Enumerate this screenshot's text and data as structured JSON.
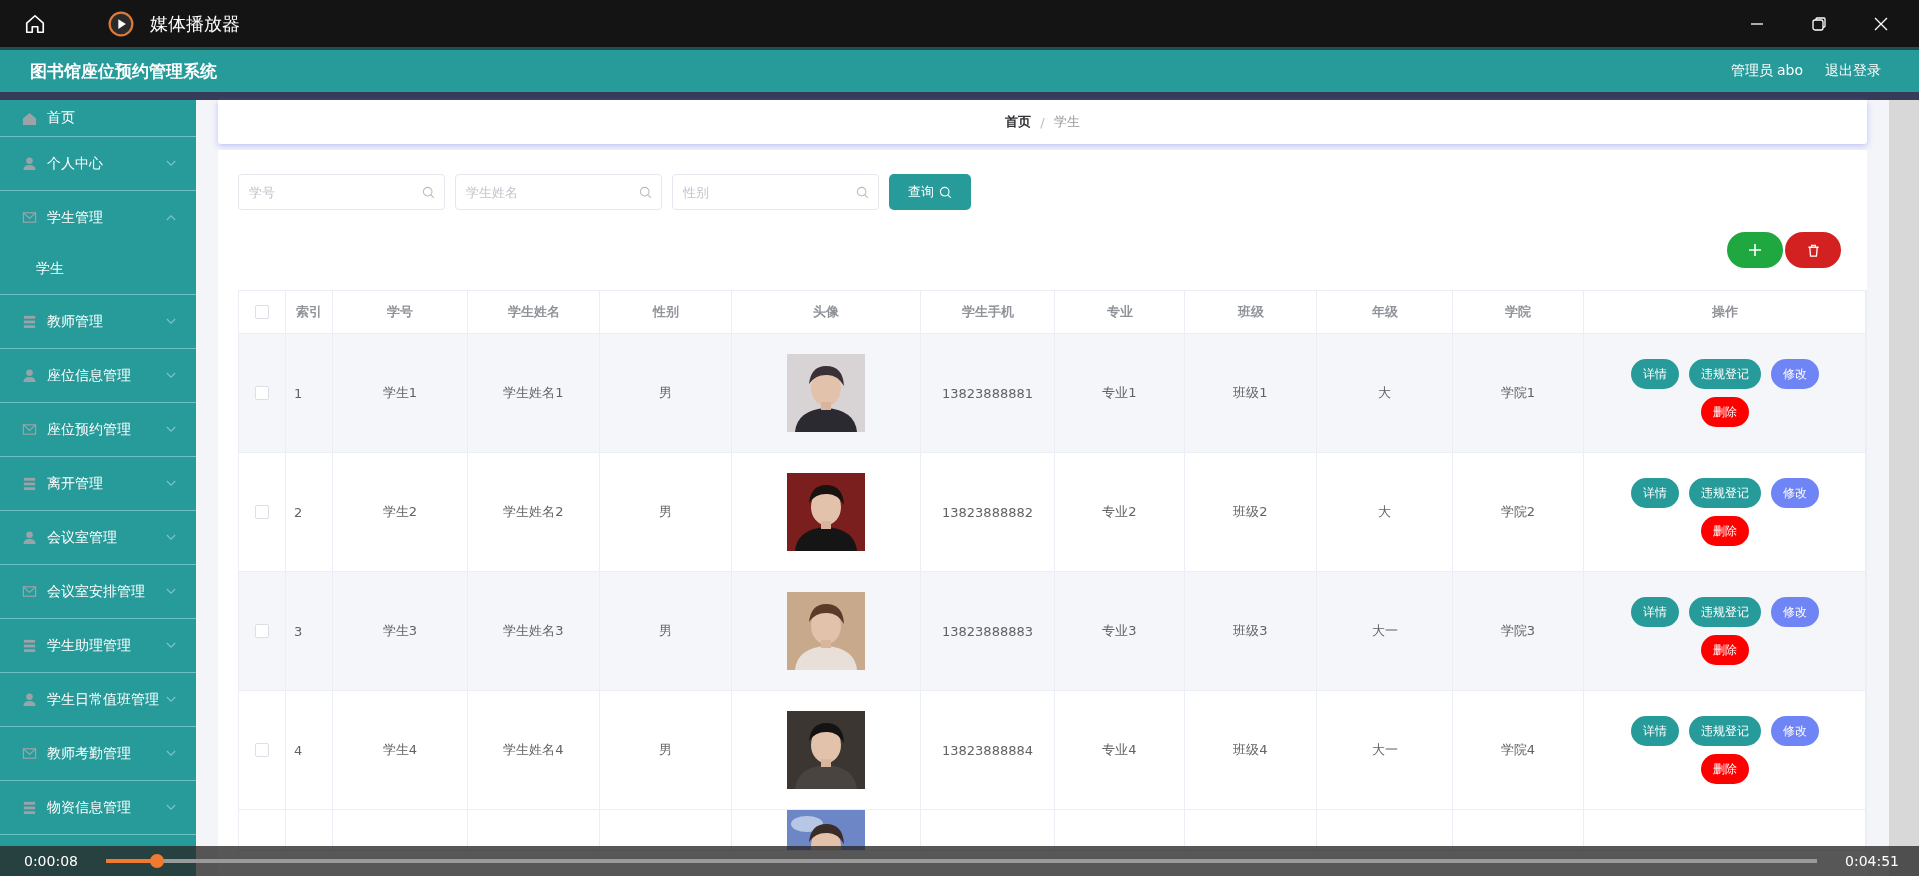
{
  "window": {
    "title": "媒体播放器"
  },
  "app": {
    "title": "图书馆座位预约管理系统",
    "user": "管理员 abo",
    "logout": "退出登录"
  },
  "sidebar": {
    "items": [
      {
        "label": "首页"
      },
      {
        "label": "个人中心",
        "expanded": false
      },
      {
        "label": "学生管理",
        "expanded": true,
        "children": [
          {
            "label": "学生"
          }
        ]
      },
      {
        "label": "教师管理",
        "expanded": false
      },
      {
        "label": "座位信息管理",
        "expanded": false
      },
      {
        "label": "座位预约管理",
        "expanded": false
      },
      {
        "label": "离开管理",
        "expanded": false
      },
      {
        "label": "会议室管理",
        "expanded": false
      },
      {
        "label": "会议室安排管理",
        "expanded": false
      },
      {
        "label": "学生助理管理",
        "expanded": false
      },
      {
        "label": "学生日常值班管理",
        "expanded": false
      },
      {
        "label": "教师考勤管理",
        "expanded": false
      },
      {
        "label": "物资信息管理",
        "expanded": false
      }
    ]
  },
  "breadcrumb": {
    "items": [
      "首页",
      "学生"
    ],
    "separator": "/"
  },
  "search": {
    "fields": [
      {
        "placeholder": "学号"
      },
      {
        "placeholder": "学生姓名"
      },
      {
        "placeholder": "性别"
      }
    ],
    "button": "查询"
  },
  "table": {
    "header_checked": false,
    "columns": [
      "索引",
      "学号",
      "学生姓名",
      "性别",
      "头像",
      "学生手机",
      "专业",
      "班级",
      "年级",
      "学院",
      "操作"
    ],
    "rows": [
      {
        "checked": false,
        "cells": [
          "1",
          "学生1",
          "学生姓名1",
          "男",
          "",
          "13823888881",
          "专业1",
          "班级1",
          "大",
          "学院1"
        ],
        "actions": [
          {
            "label": "详情",
            "kind": "detail"
          },
          {
            "label": "违规登记",
            "kind": "register"
          },
          {
            "label": "修改",
            "kind": "edit"
          },
          {
            "label": "删除",
            "kind": "delete"
          }
        ]
      },
      {
        "checked": false,
        "cells": [
          "2",
          "学生2",
          "学生姓名2",
          "男",
          "",
          "13823888882",
          "专业2",
          "班级2",
          "大",
          "学院2"
        ],
        "actions": [
          {
            "label": "详情",
            "kind": "detail"
          },
          {
            "label": "违规登记",
            "kind": "register"
          },
          {
            "label": "修改",
            "kind": "edit"
          },
          {
            "label": "删除",
            "kind": "delete"
          }
        ]
      },
      {
        "checked": false,
        "cells": [
          "3",
          "学生3",
          "学生姓名3",
          "男",
          "",
          "13823888883",
          "专业3",
          "班级3",
          "大一",
          "学院3"
        ],
        "actions": [
          {
            "label": "详情",
            "kind": "detail"
          },
          {
            "label": "违规登记",
            "kind": "register"
          },
          {
            "label": "修改",
            "kind": "edit"
          },
          {
            "label": "删除",
            "kind": "delete"
          }
        ]
      },
      {
        "checked": false,
        "cells": [
          "4",
          "学生4",
          "学生姓名4",
          "男",
          "",
          "13823888884",
          "专业4",
          "班级4",
          "大一",
          "学院4"
        ],
        "actions": [
          {
            "label": "详情",
            "kind": "detail"
          },
          {
            "label": "违规登记",
            "kind": "register"
          },
          {
            "label": "修改",
            "kind": "edit"
          },
          {
            "label": "删除",
            "kind": "delete"
          }
        ]
      }
    ]
  },
  "player": {
    "elapsed": "0:00:08",
    "total": "0:04:51",
    "level": 0.03
  }
}
